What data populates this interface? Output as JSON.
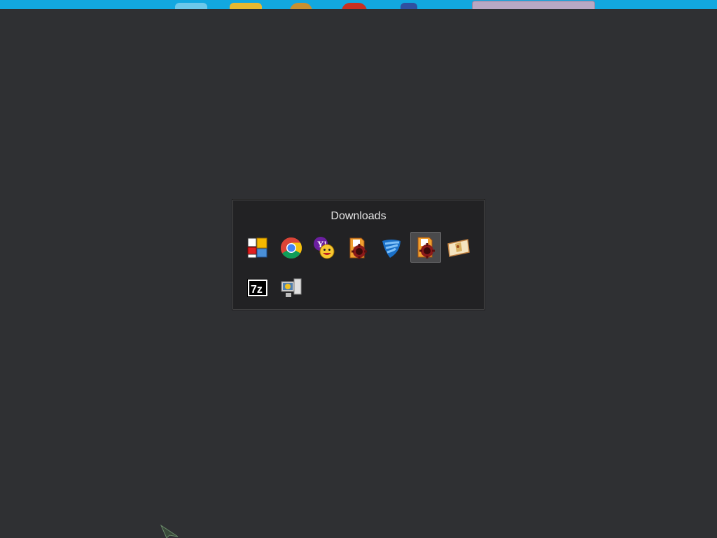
{
  "stack": {
    "title": "Downloads",
    "items": [
      {
        "icon": "tiles-installer-icon",
        "selected": false
      },
      {
        "icon": "chrome-icon",
        "selected": false
      },
      {
        "icon": "yahoo-messenger-icon",
        "selected": false
      },
      {
        "icon": "installer-gear-icon",
        "selected": false
      },
      {
        "icon": "blue-shield-icon",
        "selected": false
      },
      {
        "icon": "installer-gear-icon",
        "selected": true
      },
      {
        "icon": "map-scroll-icon",
        "selected": false
      },
      {
        "icon": "7zip-icon",
        "selected": false
      },
      {
        "icon": "computer-setup-icon",
        "selected": false
      }
    ]
  },
  "colors": {
    "background": "#2f3033",
    "panel": "#222224",
    "taskbar": "#12a8e0",
    "selection": "#4a4a4c"
  }
}
